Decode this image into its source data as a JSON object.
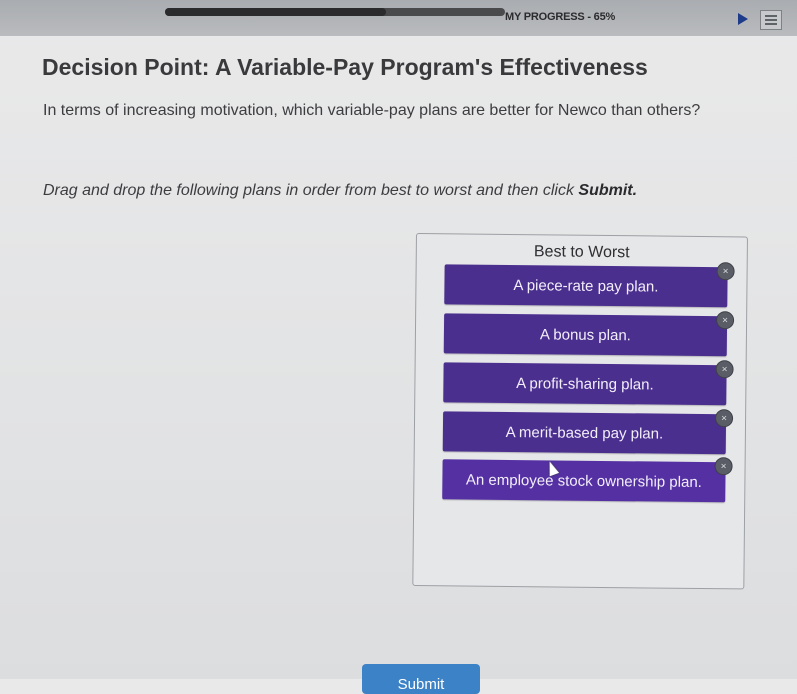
{
  "header": {
    "progress_label": "MY PROGRESS - 65%",
    "progress_value": 0.65
  },
  "main": {
    "title": "Decision Point: A Variable-Pay Program's Effectiveness",
    "prompt": "In terms of increasing motivation, which variable-pay plans are better for Newco than others?",
    "instruction_text": "Drag and drop the following plans in order from best to worst and then click ",
    "instruction_bold": "Submit.",
    "submit_label": "Submit"
  },
  "dropzone": {
    "heading": "Best to Worst",
    "remove_symbol": "×",
    "items": [
      {
        "label": "A piece-rate pay plan."
      },
      {
        "label": "A bonus plan."
      },
      {
        "label": "A profit-sharing plan."
      },
      {
        "label": "A merit-based pay plan."
      },
      {
        "label": "An employee stock ownership plan."
      }
    ]
  },
  "colors": {
    "plan_bg": "#4b2f8f",
    "submit_bg": "#3c82c6",
    "title_text": "#3a3a3c"
  }
}
